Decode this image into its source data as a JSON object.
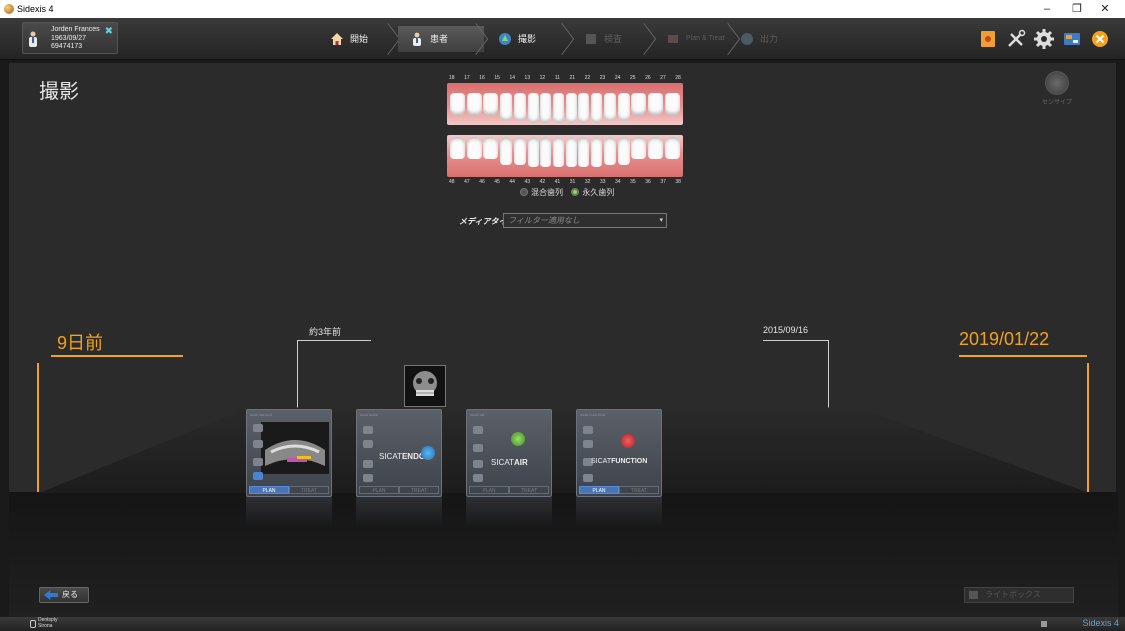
{
  "window": {
    "title": "Sidexis 4",
    "controls": {
      "minimize": "–",
      "maximize": "❐",
      "close": "✕"
    }
  },
  "patient": {
    "name": "Jorden Frances",
    "birthdate": "1963/09/27",
    "id": "69474173"
  },
  "workflow": {
    "steps": [
      {
        "label": "開始",
        "state": "normal"
      },
      {
        "label": "患者",
        "state": "active"
      },
      {
        "label": "撮影",
        "state": "normal"
      },
      {
        "label": "検査",
        "state": "disabled"
      },
      {
        "label": "Plan & Treat",
        "state": "disabled"
      },
      {
        "label": "出力",
        "state": "disabled"
      }
    ]
  },
  "page": {
    "title": "撮影"
  },
  "tooth_chart": {
    "upper_numbers": [
      "18",
      "17",
      "16",
      "15",
      "14",
      "13",
      "12",
      "11",
      "21",
      "22",
      "23",
      "24",
      "25",
      "26",
      "27",
      "28"
    ],
    "lower_numbers": [
      "48",
      "47",
      "46",
      "45",
      "44",
      "43",
      "42",
      "41",
      "31",
      "32",
      "33",
      "34",
      "35",
      "36",
      "37",
      "38"
    ],
    "dentition": {
      "options": [
        "混合歯列",
        "永久歯列"
      ],
      "selected": "永久歯列"
    }
  },
  "media_type": {
    "label": "メディアタイプ",
    "value": "フィルター適用なし"
  },
  "sensor": {
    "label": "センサイプ"
  },
  "timeline": {
    "left_date": "9日前",
    "right_date": "2019/01/22",
    "marker_left": "約3年前",
    "marker_right": "2015/09/16"
  },
  "cards": [
    {
      "name_bold": "",
      "name_thin": "",
      "header": "SICAT IMPLANT",
      "plan_label": "PLAN",
      "treat_label": "TREAT",
      "active_plan": true
    },
    {
      "name_bold": "ENDO",
      "name_thin": "SICAT",
      "header": "SICAT ENDO",
      "plan_label": "PLAN",
      "treat_label": "TREAT",
      "active_plan": false
    },
    {
      "name_bold": "AIR",
      "name_thin": "SICAT",
      "header": "SICAT AIR",
      "plan_label": "PLAN",
      "treat_label": "TREAT",
      "active_plan": false
    },
    {
      "name_bold": "FUNCTION",
      "name_thin": "SICAT",
      "header": "SICAT FUNCTION",
      "plan_label": "PLAN",
      "treat_label": "TREAT",
      "active_plan": true
    }
  ],
  "buttons": {
    "back": "戻る",
    "lightbox": "ライトボックス"
  },
  "footer": {
    "brand_line1": "Dentsply",
    "brand_line2": "Sirona",
    "app_name": "Sidexis 4"
  },
  "colors": {
    "accent_orange": "#f4a21a",
    "active_blue": "#4b74b8",
    "status_blue": "#5fa4d8"
  }
}
